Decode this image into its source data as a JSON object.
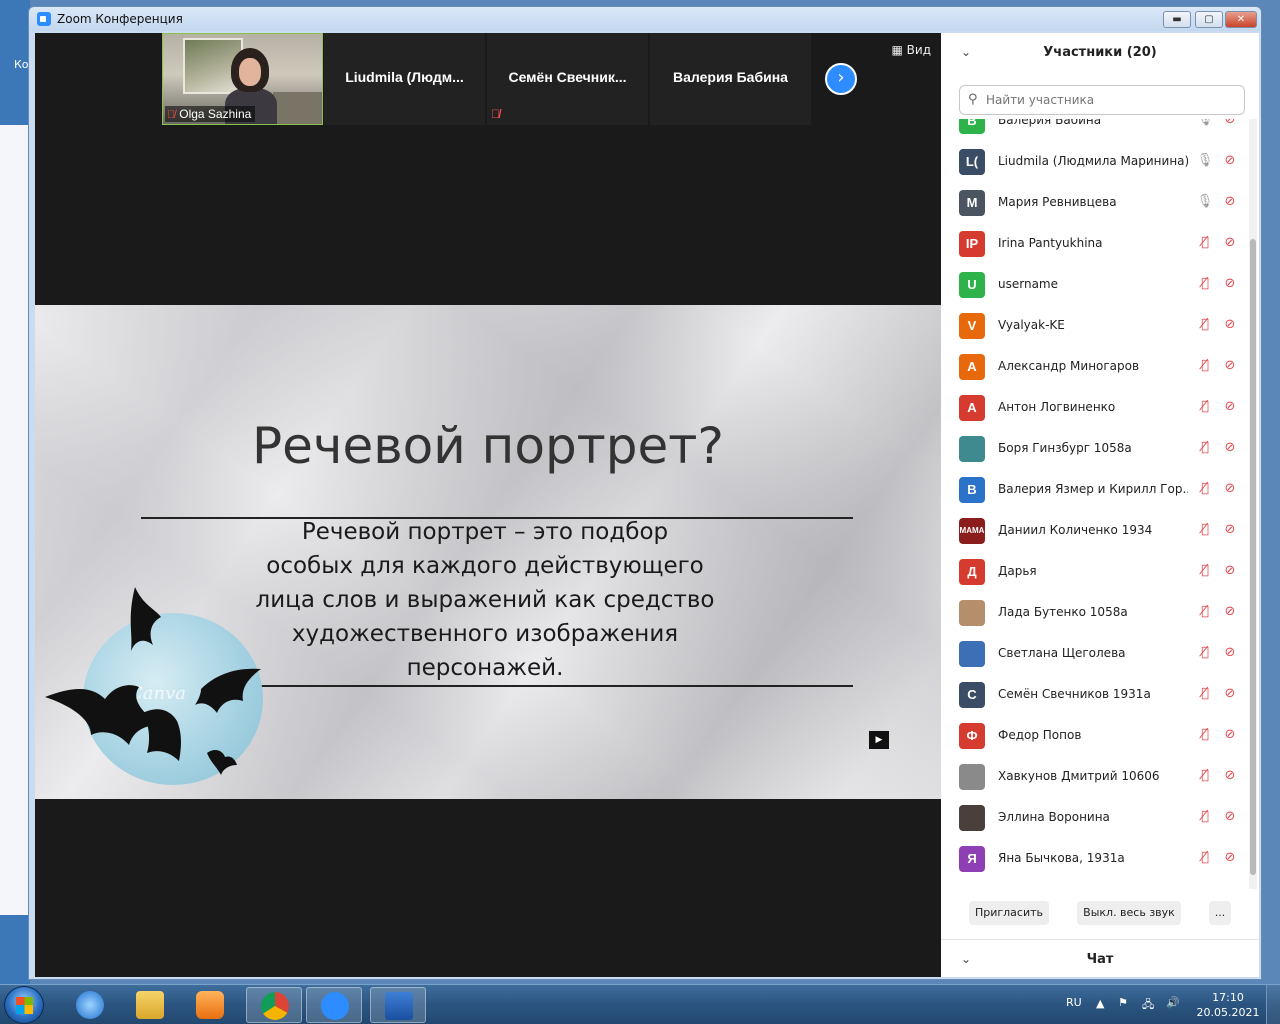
{
  "window": {
    "title": "Zoom Конференция",
    "min_label": "▬",
    "max_label": "▢",
    "close_label": "✕"
  },
  "desktop": {
    "left_fragment": "Ко"
  },
  "thumbnails": [
    {
      "name": "Olga Sazhina",
      "type": "video"
    },
    {
      "name": "Liudmila  (Людм...",
      "type": "name"
    },
    {
      "name": "Семён  Свечник...",
      "type": "name"
    },
    {
      "name": "Валерия Бабина",
      "type": "name"
    }
  ],
  "view_button": {
    "label": "Вид"
  },
  "slide": {
    "title": "Речевой портрет?",
    "lines": [
      "Речевой портрет – это подбор",
      "особых для каждого действующего",
      "лица слов и выражений как средство",
      "художественного изображения",
      "персонажей."
    ],
    "watermark": "Canva"
  },
  "participants": {
    "header": "Участники (20)",
    "search_placeholder": "Найти участника",
    "list": [
      {
        "initial": "В",
        "name": "Валерия Бабина",
        "color": "#2db34a",
        "mic": "on",
        "cam": "off"
      },
      {
        "initial": "L(",
        "name": "Liudmila (Людмила Маринина)",
        "color": "#3b4d66",
        "mic": "on",
        "cam": "off"
      },
      {
        "initial": "М",
        "name": "Мария Ревнивцева",
        "color": "#4a5561",
        "mic": "on",
        "cam": "off"
      },
      {
        "initial": "IP",
        "name": "Irina Pantyukhina",
        "color": "#d63b2f",
        "mic": "off",
        "cam": "off"
      },
      {
        "initial": "U",
        "name": "username",
        "color": "#2db34a",
        "mic": "off",
        "cam": "off"
      },
      {
        "initial": "V",
        "name": "Vyalyak-KE",
        "color": "#e8690b",
        "mic": "off",
        "cam": "off"
      },
      {
        "initial": "А",
        "name": "Александр Миногаров",
        "color": "#e8690b",
        "mic": "off",
        "cam": "off"
      },
      {
        "initial": "А",
        "name": "Антон Логвиненко",
        "color": "#d63b2f",
        "mic": "off",
        "cam": "off"
      },
      {
        "initial": "",
        "name": "Боря Гинзбург 1058а",
        "color": "#3f8a8f",
        "mic": "off",
        "cam": "off"
      },
      {
        "initial": "В",
        "name": "Валерия Язмер и Кирилл Гор...",
        "color": "#2a73c9",
        "mic": "off",
        "cam": "off"
      },
      {
        "initial": "MAMA",
        "name": "Даниил Количенко 1934",
        "color": "#8b1d1d",
        "mic": "off",
        "cam": "off"
      },
      {
        "initial": "Д",
        "name": "Дарья",
        "color": "#d63b2f",
        "mic": "off",
        "cam": "off"
      },
      {
        "initial": "",
        "name": "Лада Бутенко 1058а",
        "color": "#b58e6b",
        "mic": "off",
        "cam": "off"
      },
      {
        "initial": "",
        "name": "Светлана Щеголева",
        "color": "#3c6fb5",
        "mic": "off",
        "cam": "off"
      },
      {
        "initial": "С",
        "name": "Семён Свечников 1931а",
        "color": "#3b4d66",
        "mic": "off",
        "cam": "off"
      },
      {
        "initial": "Ф",
        "name": "Федор Попов",
        "color": "#d63b2f",
        "mic": "off",
        "cam": "off"
      },
      {
        "initial": "",
        "name": "Хавкунов Дмитрий 10606",
        "color": "#8a8a8a",
        "mic": "off",
        "cam": "off"
      },
      {
        "initial": "",
        "name": "Эллина Воронина",
        "color": "#4a3f3a",
        "mic": "off",
        "cam": "off"
      },
      {
        "initial": "Я",
        "name": "Яна Бычкова, 1931а",
        "color": "#8e3fb3",
        "mic": "off",
        "cam": "off"
      }
    ],
    "buttons": {
      "invite": "Пригласить",
      "mute_all": "Выкл. весь звук",
      "more": "..."
    },
    "chat_header": "Чат"
  },
  "taskbar": {
    "language": "RU",
    "time": "17:10",
    "date": "20.05.2021",
    "items": [
      "ie-icon",
      "explorer-icon",
      "media-player-icon",
      "chrome-icon",
      "zoom-icon",
      "word-icon"
    ]
  }
}
